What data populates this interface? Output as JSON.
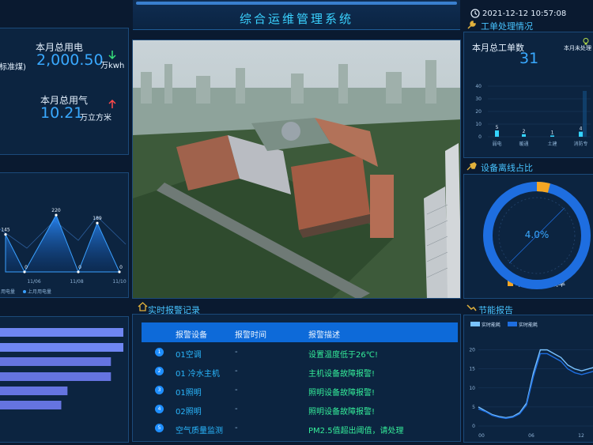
{
  "header": {
    "title": "综合运维管理系统",
    "datetime": "2021-12-12 10:57:08"
  },
  "energy": {
    "left_unit_fragment": "标准煤)",
    "electricity_label": "本月总用电",
    "electricity_value": "2,000.50",
    "electricity_unit": "万kwh",
    "gas_label": "本月总用气",
    "gas_value": "10.21",
    "gas_unit": "万立方米",
    "electricity_trend": "down",
    "gas_trend": "up",
    "colors": {
      "down": "#36e07a",
      "up": "#ff4a4a"
    }
  },
  "power_chart": {
    "chart_data": {
      "type": "area",
      "x_labels_visible": [
        "11/06",
        "11/08",
        "11/10"
      ],
      "values": [
        145,
        0,
        220,
        0,
        189,
        0
      ],
      "value_labels": [
        "145",
        "0",
        "220",
        "0",
        "189",
        "0"
      ],
      "legend": [
        "用电量",
        "上月用电量"
      ],
      "ylim": [
        0,
        260
      ]
    }
  },
  "work_orders": {
    "title": "工单处理情况",
    "total_label": "本月总工单数",
    "total_value": "31",
    "legend_unprocessed": "本月未处理",
    "chart_data": {
      "type": "bar",
      "categories": [
        "弱电",
        "暖通",
        "土建",
        "消防专"
      ],
      "values": [
        5,
        2,
        1,
        4
      ],
      "ylim": [
        0,
        40
      ],
      "yticks": [
        "40",
        "30",
        "20",
        "10",
        "0"
      ]
    }
  },
  "offline": {
    "title": "设备离线占比",
    "percent_text": "4.0%",
    "legend": "本月设备掉线率",
    "chart_data": {
      "type": "pie",
      "labels": [
        "本月设备掉线率",
        "在线"
      ],
      "values": [
        4.0,
        96.0
      ]
    }
  },
  "alarms": {
    "title": "实时报警记录",
    "headers": {
      "device": "报警设备",
      "time": "报警时间",
      "desc": "报警描述"
    },
    "rows": [
      {
        "num": "1",
        "device": "01空调",
        "time": "-",
        "desc": "设置温度低于26℃!"
      },
      {
        "num": "2",
        "device": "01 冷水主机",
        "time": "-",
        "desc": "主机设备故障报警!"
      },
      {
        "num": "3",
        "device": "01照明",
        "time": "-",
        "desc": "照明设备故障报警!"
      },
      {
        "num": "4",
        "device": "02照明",
        "time": "-",
        "desc": "照明设备故障报警!"
      },
      {
        "num": "5",
        "device": "空气质量监测",
        "time": "-",
        "desc": "PM2.5值超出阈值，请处理"
      }
    ]
  },
  "energy_saving": {
    "title": "节能报告",
    "legend": [
      "实时能耗",
      "实时能耗"
    ],
    "chart_data": {
      "type": "line",
      "x_ticks": [
        "00",
        "06",
        "12"
      ],
      "y_ticks": [
        "20",
        "15",
        "10",
        "5",
        "0"
      ],
      "ylim": [
        0,
        22
      ],
      "series": [
        {
          "values": [
            5,
            4,
            3,
            2.5,
            2.2,
            2.5,
            3.5,
            6,
            14,
            20,
            20,
            19,
            18,
            16,
            15,
            14.5,
            15,
            15.5
          ]
        },
        {
          "values": [
            4.5,
            3.8,
            2.8,
            2.3,
            2.0,
            2.3,
            3.2,
            5.5,
            13,
            19,
            19,
            18,
            17,
            15,
            14,
            13.5,
            14,
            14.5
          ]
        }
      ]
    }
  },
  "left_bars": {
    "chart_data": {
      "type": "bar",
      "values": [
        100,
        100,
        90,
        90,
        55,
        50
      ]
    }
  }
}
